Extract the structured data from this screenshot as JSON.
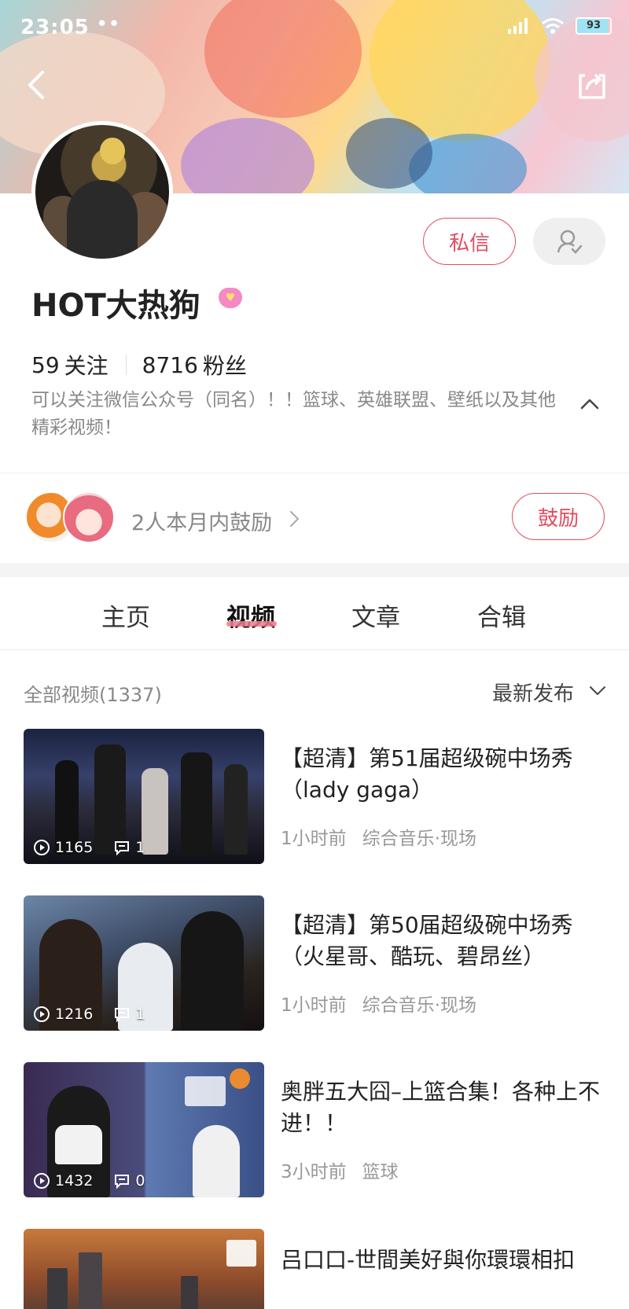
{
  "status_bar": {
    "time": "23:05",
    "dots": "••",
    "battery": "93"
  },
  "profile": {
    "username": "HOT大热狗",
    "message_button": "私信",
    "following_count": "59",
    "following_label": "关注",
    "followers_count": "8716",
    "followers_label": "粉丝",
    "bio": "可以关注微信公众号（同名）！！篮球、英雄联盟、壁纸以及其他精彩视频！"
  },
  "encourage": {
    "text": "2人本月内鼓励",
    "button": "鼓励"
  },
  "tabs": [
    {
      "label": "主页"
    },
    {
      "label": "视频"
    },
    {
      "label": "文章"
    },
    {
      "label": "合辑"
    }
  ],
  "filter": {
    "all_videos": "全部视频(1337)",
    "sort": "最新发布"
  },
  "videos": [
    {
      "title": "【超清】第51届超级碗中场秀（lady gaga）",
      "plays": "1165",
      "comments": "1",
      "time": "1小时前",
      "category": "综合音乐·现场"
    },
    {
      "title": "【超清】第50届超级碗中场秀（火星哥、酷玩、碧昂丝）",
      "plays": "1216",
      "comments": "1",
      "time": "1小时前",
      "category": "综合音乐·现场"
    },
    {
      "title": "奥胖五大囧–上篮合集！各种上不进！！",
      "plays": "1432",
      "comments": "0",
      "time": "3小时前",
      "category": "篮球"
    },
    {
      "title": "吕口口-世間美好與你環環相扣"
    }
  ],
  "colors": {
    "accent": "#e34c5f",
    "tab_underline": "#f07a8a"
  }
}
